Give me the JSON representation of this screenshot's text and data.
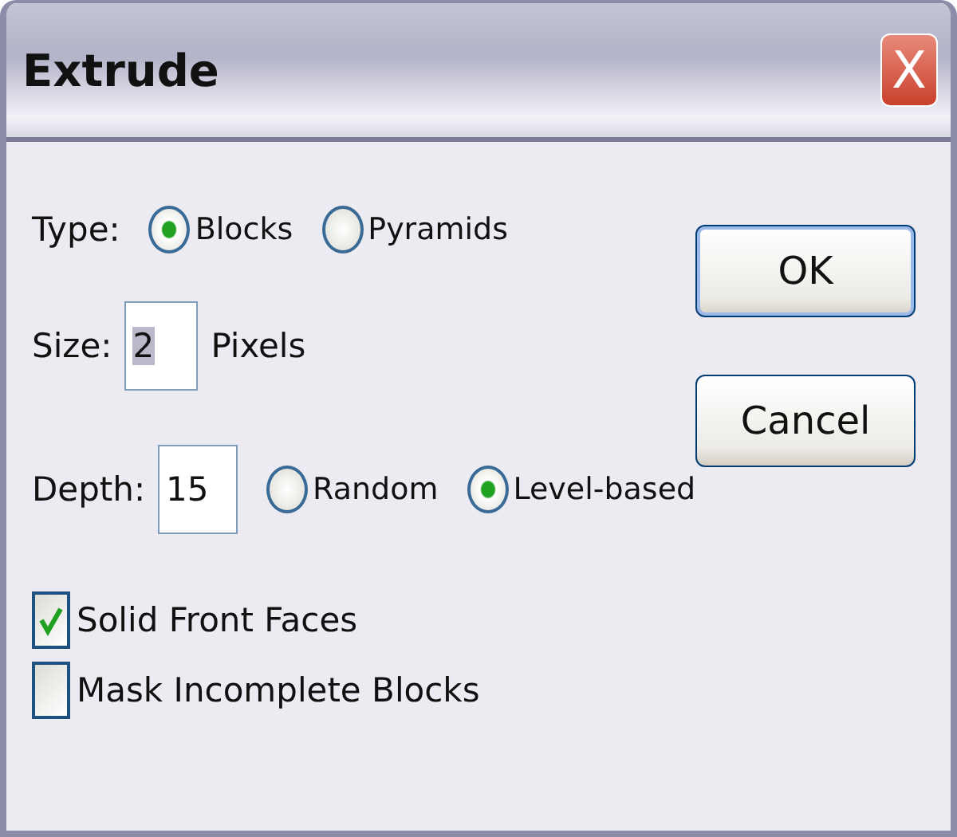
{
  "window": {
    "title": "Extrude",
    "close": "X"
  },
  "type": {
    "label": "Type:",
    "options": [
      {
        "label": "Blocks",
        "selected": true
      },
      {
        "label": "Pyramids",
        "selected": false
      }
    ]
  },
  "size": {
    "label": "Size:",
    "value": "2",
    "unit": "Pixels"
  },
  "depth": {
    "label": "Depth:",
    "value": "15",
    "options": [
      {
        "label": "Random",
        "selected": false
      },
      {
        "label": "Level-based",
        "selected": true
      }
    ]
  },
  "checkboxes": [
    {
      "label": "Solid Front Faces",
      "checked": true
    },
    {
      "label": "Mask Incomplete Blocks",
      "checked": false
    }
  ],
  "buttons": [
    {
      "label": "OK",
      "default": true
    },
    {
      "label": "Cancel",
      "default": false
    }
  ]
}
